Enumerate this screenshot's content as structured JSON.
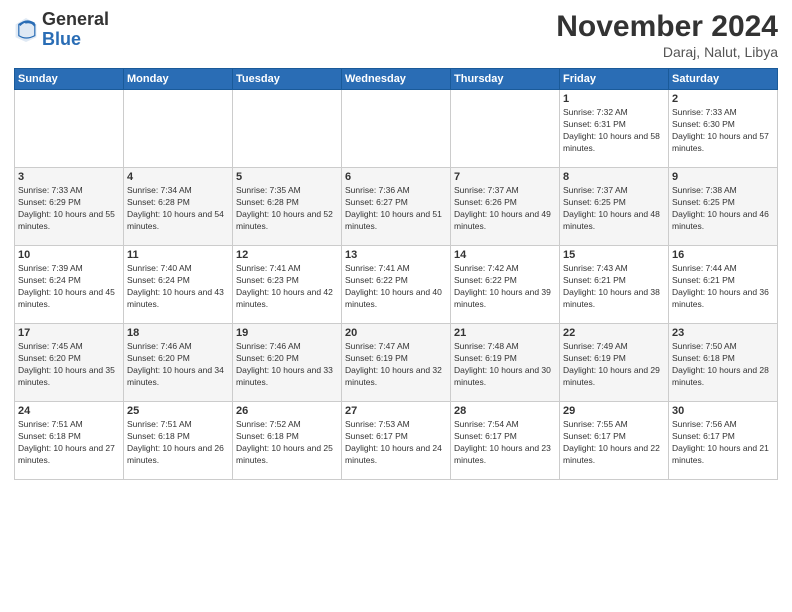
{
  "logo": {
    "general": "General",
    "blue": "Blue"
  },
  "header": {
    "month_year": "November 2024",
    "location": "Daraj, Nalut, Libya"
  },
  "days_of_week": [
    "Sunday",
    "Monday",
    "Tuesday",
    "Wednesday",
    "Thursday",
    "Friday",
    "Saturday"
  ],
  "weeks": [
    [
      {
        "day": "",
        "info": ""
      },
      {
        "day": "",
        "info": ""
      },
      {
        "day": "",
        "info": ""
      },
      {
        "day": "",
        "info": ""
      },
      {
        "day": "",
        "info": ""
      },
      {
        "day": "1",
        "info": "Sunrise: 7:32 AM\nSunset: 6:31 PM\nDaylight: 10 hours and 58 minutes."
      },
      {
        "day": "2",
        "info": "Sunrise: 7:33 AM\nSunset: 6:30 PM\nDaylight: 10 hours and 57 minutes."
      }
    ],
    [
      {
        "day": "3",
        "info": "Sunrise: 7:33 AM\nSunset: 6:29 PM\nDaylight: 10 hours and 55 minutes."
      },
      {
        "day": "4",
        "info": "Sunrise: 7:34 AM\nSunset: 6:28 PM\nDaylight: 10 hours and 54 minutes."
      },
      {
        "day": "5",
        "info": "Sunrise: 7:35 AM\nSunset: 6:28 PM\nDaylight: 10 hours and 52 minutes."
      },
      {
        "day": "6",
        "info": "Sunrise: 7:36 AM\nSunset: 6:27 PM\nDaylight: 10 hours and 51 minutes."
      },
      {
        "day": "7",
        "info": "Sunrise: 7:37 AM\nSunset: 6:26 PM\nDaylight: 10 hours and 49 minutes."
      },
      {
        "day": "8",
        "info": "Sunrise: 7:37 AM\nSunset: 6:25 PM\nDaylight: 10 hours and 48 minutes."
      },
      {
        "day": "9",
        "info": "Sunrise: 7:38 AM\nSunset: 6:25 PM\nDaylight: 10 hours and 46 minutes."
      }
    ],
    [
      {
        "day": "10",
        "info": "Sunrise: 7:39 AM\nSunset: 6:24 PM\nDaylight: 10 hours and 45 minutes."
      },
      {
        "day": "11",
        "info": "Sunrise: 7:40 AM\nSunset: 6:24 PM\nDaylight: 10 hours and 43 minutes."
      },
      {
        "day": "12",
        "info": "Sunrise: 7:41 AM\nSunset: 6:23 PM\nDaylight: 10 hours and 42 minutes."
      },
      {
        "day": "13",
        "info": "Sunrise: 7:41 AM\nSunset: 6:22 PM\nDaylight: 10 hours and 40 minutes."
      },
      {
        "day": "14",
        "info": "Sunrise: 7:42 AM\nSunset: 6:22 PM\nDaylight: 10 hours and 39 minutes."
      },
      {
        "day": "15",
        "info": "Sunrise: 7:43 AM\nSunset: 6:21 PM\nDaylight: 10 hours and 38 minutes."
      },
      {
        "day": "16",
        "info": "Sunrise: 7:44 AM\nSunset: 6:21 PM\nDaylight: 10 hours and 36 minutes."
      }
    ],
    [
      {
        "day": "17",
        "info": "Sunrise: 7:45 AM\nSunset: 6:20 PM\nDaylight: 10 hours and 35 minutes."
      },
      {
        "day": "18",
        "info": "Sunrise: 7:46 AM\nSunset: 6:20 PM\nDaylight: 10 hours and 34 minutes."
      },
      {
        "day": "19",
        "info": "Sunrise: 7:46 AM\nSunset: 6:20 PM\nDaylight: 10 hours and 33 minutes."
      },
      {
        "day": "20",
        "info": "Sunrise: 7:47 AM\nSunset: 6:19 PM\nDaylight: 10 hours and 32 minutes."
      },
      {
        "day": "21",
        "info": "Sunrise: 7:48 AM\nSunset: 6:19 PM\nDaylight: 10 hours and 30 minutes."
      },
      {
        "day": "22",
        "info": "Sunrise: 7:49 AM\nSunset: 6:19 PM\nDaylight: 10 hours and 29 minutes."
      },
      {
        "day": "23",
        "info": "Sunrise: 7:50 AM\nSunset: 6:18 PM\nDaylight: 10 hours and 28 minutes."
      }
    ],
    [
      {
        "day": "24",
        "info": "Sunrise: 7:51 AM\nSunset: 6:18 PM\nDaylight: 10 hours and 27 minutes."
      },
      {
        "day": "25",
        "info": "Sunrise: 7:51 AM\nSunset: 6:18 PM\nDaylight: 10 hours and 26 minutes."
      },
      {
        "day": "26",
        "info": "Sunrise: 7:52 AM\nSunset: 6:18 PM\nDaylight: 10 hours and 25 minutes."
      },
      {
        "day": "27",
        "info": "Sunrise: 7:53 AM\nSunset: 6:17 PM\nDaylight: 10 hours and 24 minutes."
      },
      {
        "day": "28",
        "info": "Sunrise: 7:54 AM\nSunset: 6:17 PM\nDaylight: 10 hours and 23 minutes."
      },
      {
        "day": "29",
        "info": "Sunrise: 7:55 AM\nSunset: 6:17 PM\nDaylight: 10 hours and 22 minutes."
      },
      {
        "day": "30",
        "info": "Sunrise: 7:56 AM\nSunset: 6:17 PM\nDaylight: 10 hours and 21 minutes."
      }
    ]
  ]
}
